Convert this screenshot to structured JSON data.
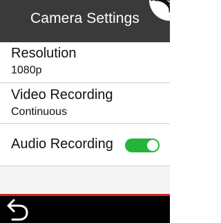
{
  "header": {
    "title": "Camera Settings"
  },
  "icons": {
    "signal": "signal-icon",
    "back": "back-arrow-icon"
  },
  "settings": {
    "items": [
      {
        "title": "Resolution",
        "value": "1080p"
      },
      {
        "title": "Video Recording",
        "value": "Continuous"
      },
      {
        "title": "Audio Recording",
        "toggle_on": true
      }
    ]
  },
  "colors": {
    "header_bg": "#3a3a3a",
    "toggle_on": "#25b53a",
    "accent_line": "#d6231c",
    "footer_bg": "#000000"
  }
}
